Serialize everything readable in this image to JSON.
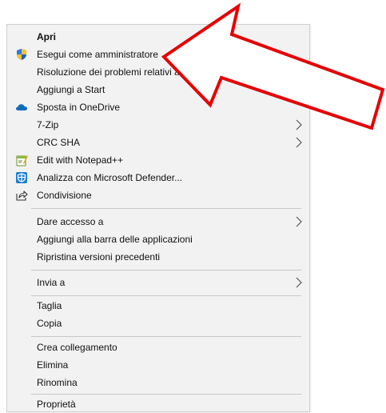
{
  "context_menu": {
    "items": [
      {
        "label": "Apri",
        "bold": true,
        "icon": null,
        "submenu": false
      },
      {
        "label": "Esegui come amministratore",
        "icon": "uac-shield-icon",
        "submenu": false
      },
      {
        "label": "Risoluzione dei problemi relativi alla compatibilità",
        "icon": null,
        "submenu": false
      },
      {
        "label": "Aggiungi a Start",
        "icon": null,
        "submenu": false
      },
      {
        "label": "Sposta in OneDrive",
        "icon": "onedrive-cloud-icon",
        "submenu": false
      },
      {
        "label": "7-Zip",
        "icon": null,
        "submenu": true
      },
      {
        "label": "CRC SHA",
        "icon": null,
        "submenu": true
      },
      {
        "label": "Edit with Notepad++",
        "icon": "notepadpp-icon",
        "submenu": false
      },
      {
        "label": "Analizza con Microsoft Defender...",
        "icon": "defender-icon",
        "submenu": false
      },
      {
        "label": "Condivisione",
        "icon": "share-icon",
        "submenu": false
      },
      {
        "label": "Dare accesso a",
        "icon": null,
        "submenu": true
      },
      {
        "label": "Aggiungi alla barra delle applicazioni",
        "icon": null,
        "submenu": false
      },
      {
        "label": "Ripristina versioni precedenti",
        "icon": null,
        "submenu": false
      },
      {
        "label": "Invia a",
        "icon": null,
        "submenu": true
      },
      {
        "label": "Taglia",
        "icon": null,
        "submenu": false
      },
      {
        "label": "Copia",
        "icon": null,
        "submenu": false
      },
      {
        "label": "Crea collegamento",
        "icon": null,
        "submenu": false
      },
      {
        "label": "Elimina",
        "icon": null,
        "submenu": false
      },
      {
        "label": "Rinomina",
        "icon": null,
        "submenu": false
      },
      {
        "label": "Proprietà",
        "icon": null,
        "submenu": false
      }
    ]
  },
  "annotation": {
    "arrow_color": "#e60000",
    "arrow_fill": "#ffffff",
    "points_to": "Esegui come amministratore"
  }
}
